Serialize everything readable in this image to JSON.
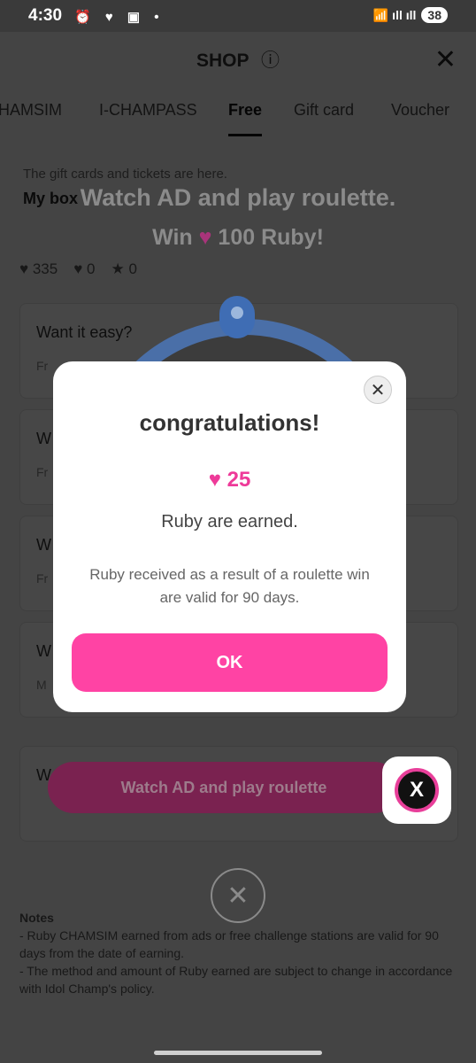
{
  "status": {
    "time": "4:30",
    "icons": "⏰ ♥ ▣ •",
    "signal": "📶 ıll ıll",
    "battery": "38"
  },
  "header": {
    "title": "SHOP",
    "info_icon": "ⓘ"
  },
  "tabs": [
    "HAMSIM",
    "I-CHAMPASS",
    "Free",
    "Gift card",
    "Voucher"
  ],
  "notice": "The gift cards and tickets are here.",
  "mybox": "My box",
  "counts": {
    "ruby": "335",
    "blue": "0",
    "star": "0"
  },
  "roulette": {
    "heading": "Watch AD and play roulette.",
    "win_prefix": "Win",
    "win_suffix": "100 Ruby!"
  },
  "cards": [
    {
      "title": "Want it easy?",
      "sub": "Fr"
    },
    {
      "title": "W",
      "sub": "Fr"
    },
    {
      "title": "W",
      "sub": "Fr"
    },
    {
      "title": "W",
      "sub": "M"
    },
    {
      "title": "W",
      "sub": ""
    }
  ],
  "watch_button": "Watch AD and play roulette",
  "notes": {
    "heading": "Notes",
    "items": [
      "- Ruby CHAMSIM earned from ads or free challenge stations are valid for 90 days from the date of earning.",
      "- The method and amount of Ruby earned are subject to change in accordance with Idol Champ's policy."
    ]
  },
  "modal": {
    "title": "congratulations!",
    "amount": "25",
    "earned": "Ruby are earned.",
    "validity": "Ruby received as a result of a roulette win are valid for 90 days.",
    "ok": "OK"
  },
  "colors": {
    "accent": "#ff43a4",
    "ruby": "#ee3a99"
  }
}
